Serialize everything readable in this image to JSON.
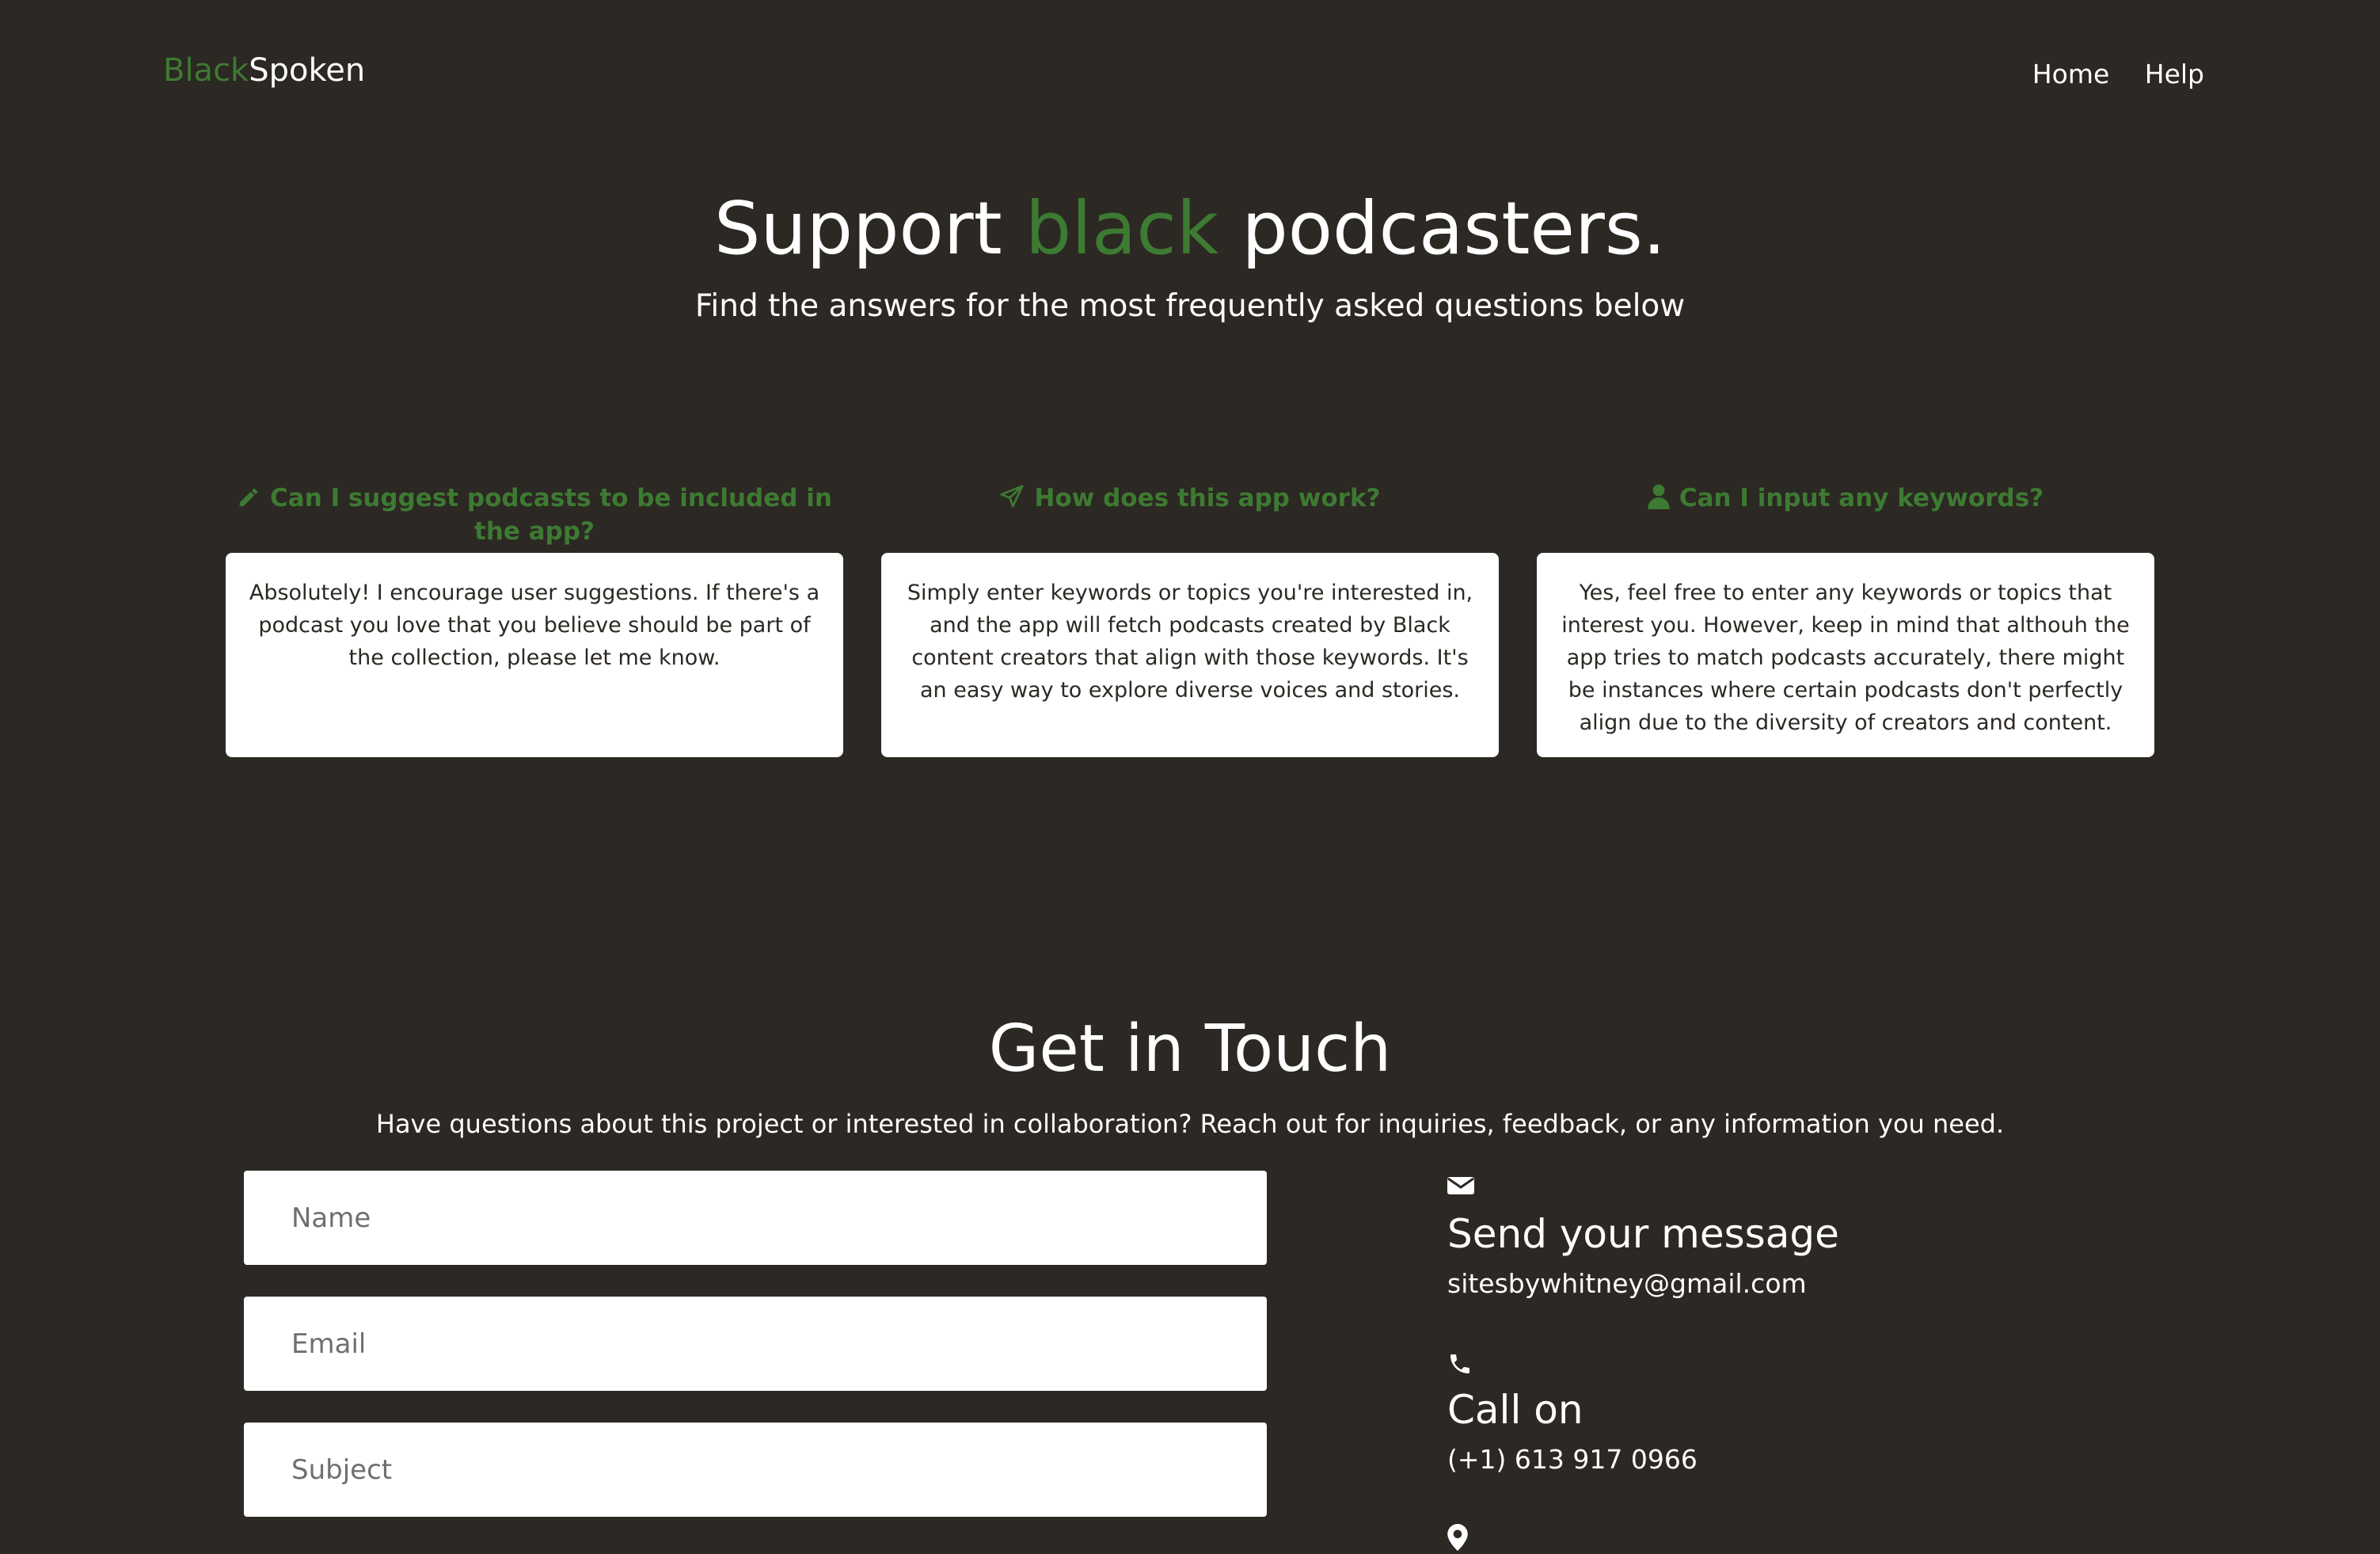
{
  "brand": {
    "part1": "Black",
    "part2": "Spoken"
  },
  "nav": {
    "home": "Home",
    "help": "Help"
  },
  "hero": {
    "title_part1": "Support ",
    "title_highlight": "black",
    "title_part2": " podcasters.",
    "subtitle": "Find the answers for the most frequently asked questions below"
  },
  "faqs": [
    {
      "icon": "pencil-icon",
      "question": "Can I suggest podcasts to be included in the app?",
      "answer": "Absolutely! I encourage user suggestions. If there's a podcast you love that you believe should be part of the collection, please let me know."
    },
    {
      "icon": "paper-plane-icon",
      "question": "How does this app work?",
      "answer": "Simply enter keywords or topics you're interested in, and the app will fetch podcasts created by Black content creators that align with those keywords. It's an easy way to explore diverse voices and stories."
    },
    {
      "icon": "user-icon",
      "question": "Can I input any keywords?",
      "answer": "Yes, feel free to enter any keywords or topics that interest you. However, keep in mind that althouh the app tries to match podcasts accurately, there might be instances where certain podcasts don't perfectly align due to the diversity of creators and content."
    }
  ],
  "contact": {
    "title": "Get in Touch",
    "subtitle": "Have questions about this project or interested in collaboration? Reach out for inquiries, feedback, or any information you need.",
    "name_placeholder": "Name",
    "email_placeholder": "Email",
    "subject_placeholder": "Subject"
  },
  "info": {
    "mail": {
      "icon": "envelope-icon",
      "title": "Send your message",
      "value": "sitesbywhitney@gmail.com"
    },
    "phone": {
      "icon": "phone-icon",
      "title": "Call on",
      "value": "(+1) 613 917 0966"
    },
    "location": {
      "icon": "location-pin-icon"
    }
  },
  "colors": {
    "background": "#2c2823",
    "accent": "#3d7a32",
    "card": "#ffffff"
  }
}
